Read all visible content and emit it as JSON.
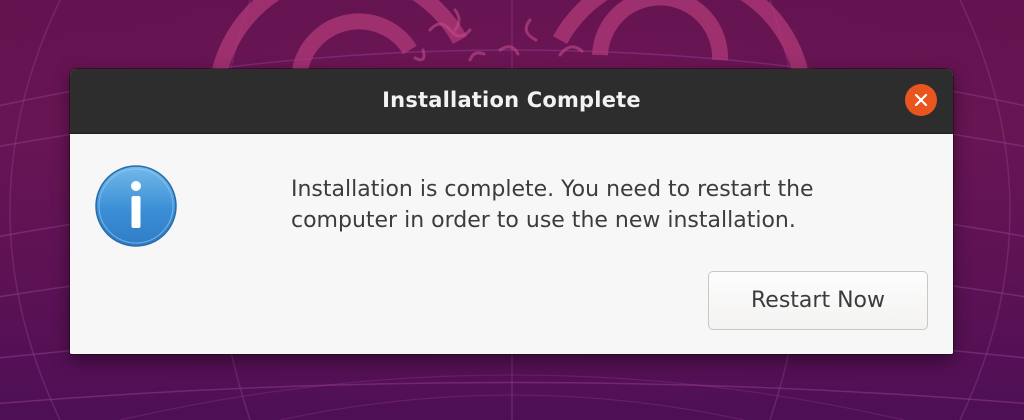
{
  "dialog": {
    "title": "Installation Complete",
    "message": "Installation is complete. You need to restart the computer in order to use the new installation.",
    "restart_button_label": "Restart Now",
    "icon": "info-icon",
    "close_icon": "close-icon"
  },
  "colors": {
    "titlebar": "#2d2d2d",
    "close_button": "#e9541f",
    "dialog_background": "#f7f7f7",
    "desktop_background": "#5e1254"
  }
}
